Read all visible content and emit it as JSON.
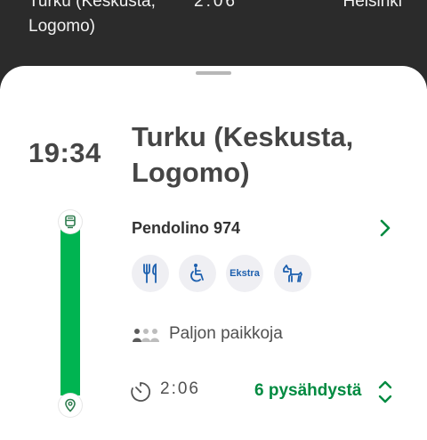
{
  "header": {
    "origin": "Turku (Keskusta, Logomo)",
    "duration": "2:06",
    "destination": "Helsinki"
  },
  "departure": {
    "time": "19:34",
    "station": "Turku (Keskusta, Logomo)"
  },
  "train": {
    "name": "Pendolino 974"
  },
  "services": [
    {
      "icon": "restaurant-icon"
    },
    {
      "icon": "wheelchair-icon"
    },
    {
      "icon": "ekstra-class",
      "label": "Ekstra"
    },
    {
      "icon": "pet-icon"
    }
  ],
  "occupancy": {
    "text": "Paljon paikkoja"
  },
  "journey": {
    "duration": "2:06",
    "stops_label": "6 pysähdystä"
  },
  "colors": {
    "track": "#00b451",
    "accent_green": "#008a40",
    "service_blue": "#1c5fae",
    "header_bg": "#2b2b2b"
  }
}
